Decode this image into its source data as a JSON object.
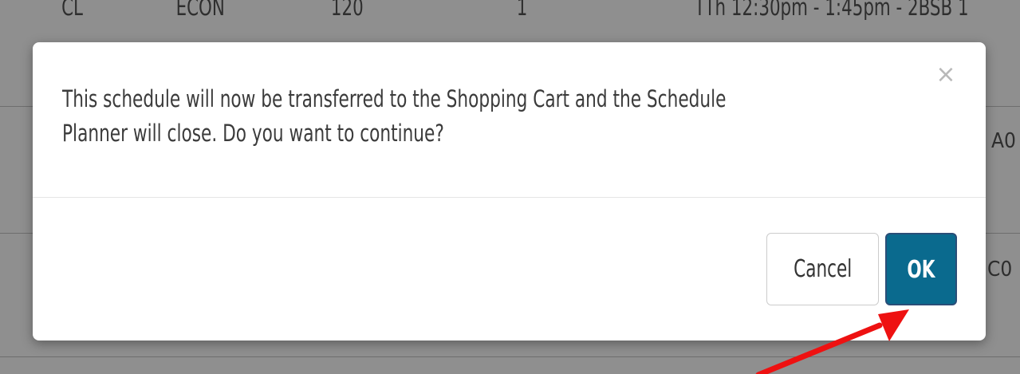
{
  "background_row": {
    "cells": [
      "CL",
      "ECON",
      "120",
      "1",
      "TTh 12:30pm - 1:45pm - 2BSB 1"
    ]
  },
  "background_fragments": {
    "row2": "A0",
    "row3": "C0"
  },
  "dialog": {
    "close_glyph": "×",
    "message_line1": "This schedule will now be transferred to the Shopping Cart and the Schedule",
    "message_line2": "Planner will close. Do you want to continue?",
    "cancel_label": "Cancel",
    "ok_label": "OK"
  },
  "colors": {
    "primary_button": "#0a6a8e",
    "annotation_arrow": "#ee1111"
  },
  "annotation": {
    "icon": "arrow-pointing-icon"
  }
}
